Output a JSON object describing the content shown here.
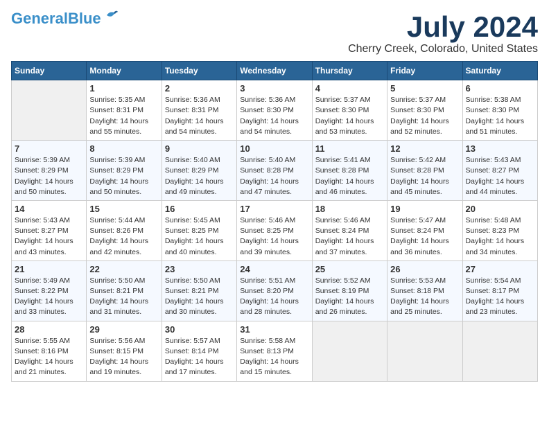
{
  "app": {
    "logo_general": "General",
    "logo_blue": "Blue",
    "month": "July 2024",
    "location": "Cherry Creek, Colorado, United States"
  },
  "calendar": {
    "headers": [
      "Sunday",
      "Monday",
      "Tuesday",
      "Wednesday",
      "Thursday",
      "Friday",
      "Saturday"
    ],
    "weeks": [
      [
        {
          "day": "",
          "sunrise": "",
          "sunset": "",
          "daylight": ""
        },
        {
          "day": "1",
          "sunrise": "Sunrise: 5:35 AM",
          "sunset": "Sunset: 8:31 PM",
          "daylight": "Daylight: 14 hours and 55 minutes."
        },
        {
          "day": "2",
          "sunrise": "Sunrise: 5:36 AM",
          "sunset": "Sunset: 8:31 PM",
          "daylight": "Daylight: 14 hours and 54 minutes."
        },
        {
          "day": "3",
          "sunrise": "Sunrise: 5:36 AM",
          "sunset": "Sunset: 8:30 PM",
          "daylight": "Daylight: 14 hours and 54 minutes."
        },
        {
          "day": "4",
          "sunrise": "Sunrise: 5:37 AM",
          "sunset": "Sunset: 8:30 PM",
          "daylight": "Daylight: 14 hours and 53 minutes."
        },
        {
          "day": "5",
          "sunrise": "Sunrise: 5:37 AM",
          "sunset": "Sunset: 8:30 PM",
          "daylight": "Daylight: 14 hours and 52 minutes."
        },
        {
          "day": "6",
          "sunrise": "Sunrise: 5:38 AM",
          "sunset": "Sunset: 8:30 PM",
          "daylight": "Daylight: 14 hours and 51 minutes."
        }
      ],
      [
        {
          "day": "7",
          "sunrise": "Sunrise: 5:39 AM",
          "sunset": "Sunset: 8:29 PM",
          "daylight": "Daylight: 14 hours and 50 minutes."
        },
        {
          "day": "8",
          "sunrise": "Sunrise: 5:39 AM",
          "sunset": "Sunset: 8:29 PM",
          "daylight": "Daylight: 14 hours and 50 minutes."
        },
        {
          "day": "9",
          "sunrise": "Sunrise: 5:40 AM",
          "sunset": "Sunset: 8:29 PM",
          "daylight": "Daylight: 14 hours and 49 minutes."
        },
        {
          "day": "10",
          "sunrise": "Sunrise: 5:40 AM",
          "sunset": "Sunset: 8:28 PM",
          "daylight": "Daylight: 14 hours and 47 minutes."
        },
        {
          "day": "11",
          "sunrise": "Sunrise: 5:41 AM",
          "sunset": "Sunset: 8:28 PM",
          "daylight": "Daylight: 14 hours and 46 minutes."
        },
        {
          "day": "12",
          "sunrise": "Sunrise: 5:42 AM",
          "sunset": "Sunset: 8:28 PM",
          "daylight": "Daylight: 14 hours and 45 minutes."
        },
        {
          "day": "13",
          "sunrise": "Sunrise: 5:43 AM",
          "sunset": "Sunset: 8:27 PM",
          "daylight": "Daylight: 14 hours and 44 minutes."
        }
      ],
      [
        {
          "day": "14",
          "sunrise": "Sunrise: 5:43 AM",
          "sunset": "Sunset: 8:27 PM",
          "daylight": "Daylight: 14 hours and 43 minutes."
        },
        {
          "day": "15",
          "sunrise": "Sunrise: 5:44 AM",
          "sunset": "Sunset: 8:26 PM",
          "daylight": "Daylight: 14 hours and 42 minutes."
        },
        {
          "day": "16",
          "sunrise": "Sunrise: 5:45 AM",
          "sunset": "Sunset: 8:25 PM",
          "daylight": "Daylight: 14 hours and 40 minutes."
        },
        {
          "day": "17",
          "sunrise": "Sunrise: 5:46 AM",
          "sunset": "Sunset: 8:25 PM",
          "daylight": "Daylight: 14 hours and 39 minutes."
        },
        {
          "day": "18",
          "sunrise": "Sunrise: 5:46 AM",
          "sunset": "Sunset: 8:24 PM",
          "daylight": "Daylight: 14 hours and 37 minutes."
        },
        {
          "day": "19",
          "sunrise": "Sunrise: 5:47 AM",
          "sunset": "Sunset: 8:24 PM",
          "daylight": "Daylight: 14 hours and 36 minutes."
        },
        {
          "day": "20",
          "sunrise": "Sunrise: 5:48 AM",
          "sunset": "Sunset: 8:23 PM",
          "daylight": "Daylight: 14 hours and 34 minutes."
        }
      ],
      [
        {
          "day": "21",
          "sunrise": "Sunrise: 5:49 AM",
          "sunset": "Sunset: 8:22 PM",
          "daylight": "Daylight: 14 hours and 33 minutes."
        },
        {
          "day": "22",
          "sunrise": "Sunrise: 5:50 AM",
          "sunset": "Sunset: 8:21 PM",
          "daylight": "Daylight: 14 hours and 31 minutes."
        },
        {
          "day": "23",
          "sunrise": "Sunrise: 5:50 AM",
          "sunset": "Sunset: 8:21 PM",
          "daylight": "Daylight: 14 hours and 30 minutes."
        },
        {
          "day": "24",
          "sunrise": "Sunrise: 5:51 AM",
          "sunset": "Sunset: 8:20 PM",
          "daylight": "Daylight: 14 hours and 28 minutes."
        },
        {
          "day": "25",
          "sunrise": "Sunrise: 5:52 AM",
          "sunset": "Sunset: 8:19 PM",
          "daylight": "Daylight: 14 hours and 26 minutes."
        },
        {
          "day": "26",
          "sunrise": "Sunrise: 5:53 AM",
          "sunset": "Sunset: 8:18 PM",
          "daylight": "Daylight: 14 hours and 25 minutes."
        },
        {
          "day": "27",
          "sunrise": "Sunrise: 5:54 AM",
          "sunset": "Sunset: 8:17 PM",
          "daylight": "Daylight: 14 hours and 23 minutes."
        }
      ],
      [
        {
          "day": "28",
          "sunrise": "Sunrise: 5:55 AM",
          "sunset": "Sunset: 8:16 PM",
          "daylight": "Daylight: 14 hours and 21 minutes."
        },
        {
          "day": "29",
          "sunrise": "Sunrise: 5:56 AM",
          "sunset": "Sunset: 8:15 PM",
          "daylight": "Daylight: 14 hours and 19 minutes."
        },
        {
          "day": "30",
          "sunrise": "Sunrise: 5:57 AM",
          "sunset": "Sunset: 8:14 PM",
          "daylight": "Daylight: 14 hours and 17 minutes."
        },
        {
          "day": "31",
          "sunrise": "Sunrise: 5:58 AM",
          "sunset": "Sunset: 8:13 PM",
          "daylight": "Daylight: 14 hours and 15 minutes."
        },
        {
          "day": "",
          "sunrise": "",
          "sunset": "",
          "daylight": ""
        },
        {
          "day": "",
          "sunrise": "",
          "sunset": "",
          "daylight": ""
        },
        {
          "day": "",
          "sunrise": "",
          "sunset": "",
          "daylight": ""
        }
      ]
    ]
  }
}
